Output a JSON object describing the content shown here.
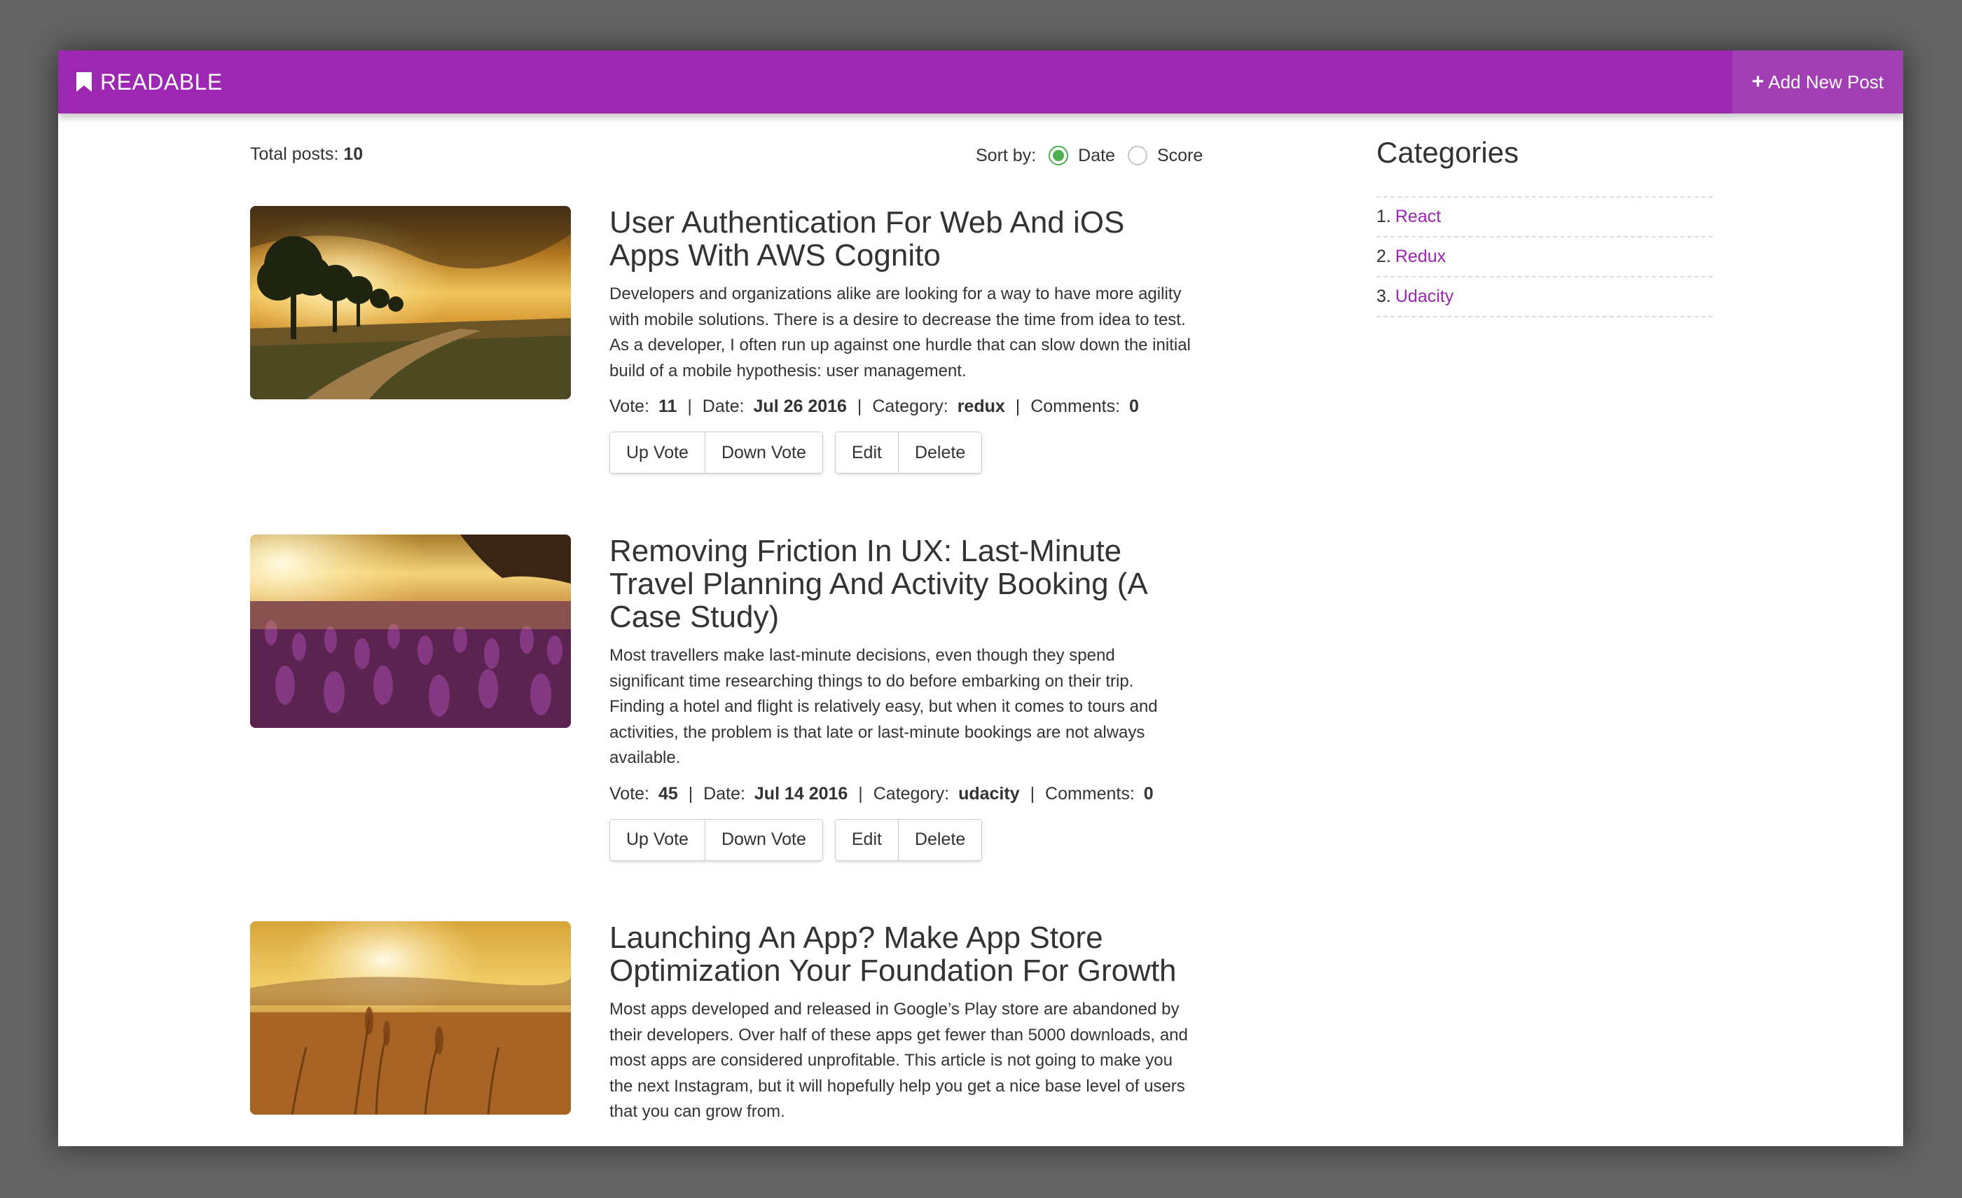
{
  "navbar": {
    "brand": "READABLE",
    "add_post_label": "Add New Post",
    "color": "#9c27b0"
  },
  "summary": {
    "total_label": "Total posts:",
    "total_count": "10"
  },
  "sort": {
    "label": "Sort by:",
    "options": [
      {
        "label": "Date",
        "selected": true
      },
      {
        "label": "Score",
        "selected": false
      }
    ]
  },
  "posts": [
    {
      "title": "User Authentication For Web And iOS Apps With AWS Cognito",
      "excerpt": "Developers and organizations alike are looking for a way to have more agility with mobile solutions. There is a desire to decrease the time from idea to test. As a developer, I often run up against one hurdle that can slow down the initial build of a mobile hypothesis: user management.",
      "vote_label": "Vote:",
      "vote": "11",
      "date_label": "Date:",
      "date": "Jul 26 2016",
      "category_label": "Category:",
      "category": "redux",
      "comments_label": "Comments:",
      "comments": "0",
      "image": "sunset-trees-field"
    },
    {
      "title": "Removing Friction In UX: Last-Minute Travel Planning And Activity Booking (A Case Study)",
      "excerpt": "Most travellers make last-minute decisions, even though they spend significant time researching things to do before embarking on their trip. Finding a hotel and flight is relatively easy, but when it comes to tours and activities, the problem is that late or last-minute bookings are not always available.",
      "vote_label": "Vote:",
      "vote": "45",
      "date_label": "Date:",
      "date": "Jul 14 2016",
      "category_label": "Category:",
      "category": "udacity",
      "comments_label": "Comments:",
      "comments": "0",
      "image": "sunset-flower-field"
    },
    {
      "title": "Launching An App? Make App Store Optimization Your Foundation For Growth",
      "excerpt": "Most apps developed and released in Google’s Play store are abandoned by their developers. Over half of these apps get fewer than 5000 downloads, and most apps are considered unprofitable. This article is not going to make you the next Instagram, but it will hopefully help you get a nice base level of users that you can grow from.",
      "image": "golden-wheat-field"
    }
  ],
  "buttons": {
    "up_vote": "Up Vote",
    "down_vote": "Down Vote",
    "edit": "Edit",
    "delete": "Delete"
  },
  "separator": "|",
  "categories": {
    "heading": "Categories",
    "items": [
      {
        "number": "1.",
        "name": "React"
      },
      {
        "number": "2.",
        "name": "Redux"
      },
      {
        "number": "3.",
        "name": "Udacity"
      }
    ]
  }
}
